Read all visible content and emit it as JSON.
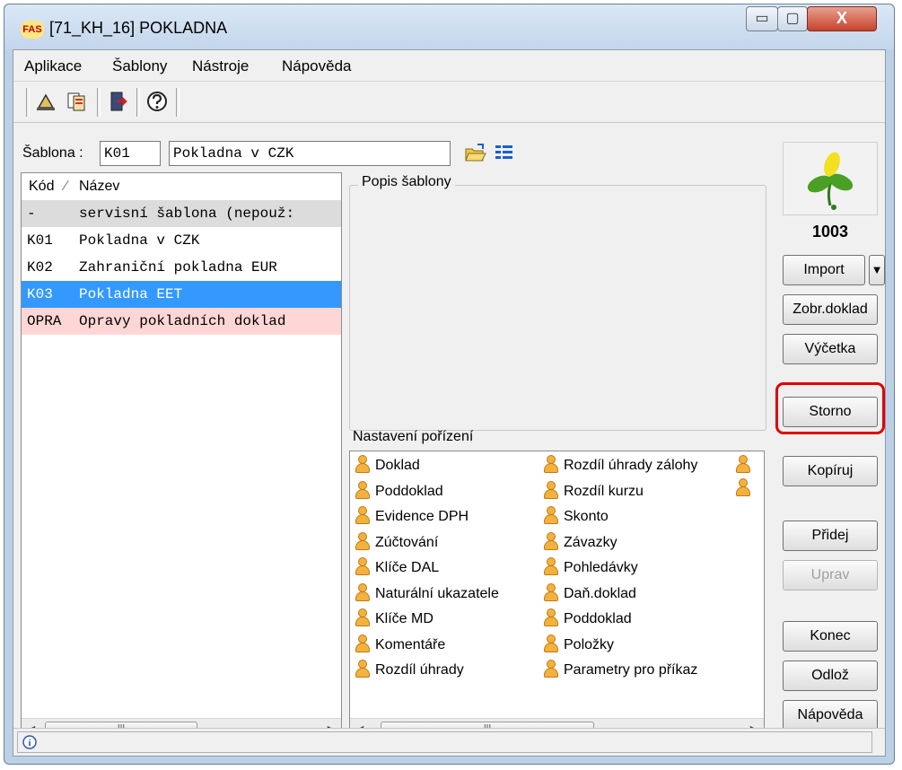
{
  "window": {
    "app_logo_text": "FAS",
    "title": "[71_KH_16] POKLADNA",
    "minimize_glyph": "▭",
    "maximize_glyph": "▢",
    "close_glyph": "X"
  },
  "menu": [
    "Aplikace",
    "Šablony",
    "Nástroje",
    "Nápověda"
  ],
  "toolbar": {
    "icons": [
      "edit-icon",
      "document-icon",
      "exit-door-icon",
      "help-icon"
    ]
  },
  "template": {
    "label": "Šablona :",
    "code": "K01",
    "name": "Pokladna v CZK",
    "icons": [
      "open-folder-icon",
      "list-icon"
    ]
  },
  "list": {
    "headers": {
      "code": "Kód",
      "sort_mark": "⁄",
      "name": "Název"
    },
    "rows": [
      {
        "code": "-",
        "name": "servisní šablona (nepouž:",
        "style": "gray"
      },
      {
        "code": "K01",
        "name": "Pokladna v CZK",
        "style": "normal"
      },
      {
        "code": "K02",
        "name": "Zahraniční pokladna EUR",
        "style": "normal"
      },
      {
        "code": "K03",
        "name": "Pokladna EET",
        "style": "selected"
      },
      {
        "code": "OPRA",
        "name": "Opravy pokladních doklad",
        "style": "pink"
      }
    ],
    "scroll_thumb": "III"
  },
  "description": {
    "title": "Popis šablony"
  },
  "settings": {
    "title": "Nastavení pořízení",
    "left": [
      "Doklad",
      "Poddoklad",
      "Evidence DPH",
      "Zúčtování",
      "Klíče DAL",
      "Naturální ukazatele",
      "Klíče MD",
      "Komentáře",
      "Rozdíl úhrady"
    ],
    "right": [
      "Rozdíl úhrady zálohy",
      "Rozdíl kurzu",
      "Skonto",
      "Závazky",
      "Pohledávky",
      "Daň.doklad",
      "Poddoklad",
      "Položky",
      "Parametry pro příkaz"
    ],
    "scroll_thumb": "III"
  },
  "sidebar": {
    "counter": "1003",
    "buttons": {
      "import": "Import",
      "import_arrow": "▼",
      "zobr_doklad": "Zobr.doklad",
      "vycetka": "Výčetka",
      "storno": "Storno",
      "kopiruj": "Kopíruj",
      "pridej": "Přidej",
      "uprav": "Uprav",
      "konec": "Konec",
      "odloz": "Odlož",
      "napoveda": "Nápověda"
    }
  },
  "status": {
    "icon": "info-icon",
    "icon_glyph": "i"
  },
  "colors": {
    "selected_row": "#3399ff",
    "pink_row": "#ffd6d6",
    "gray_row": "#dcdcdc",
    "highlight": "#e00000"
  }
}
